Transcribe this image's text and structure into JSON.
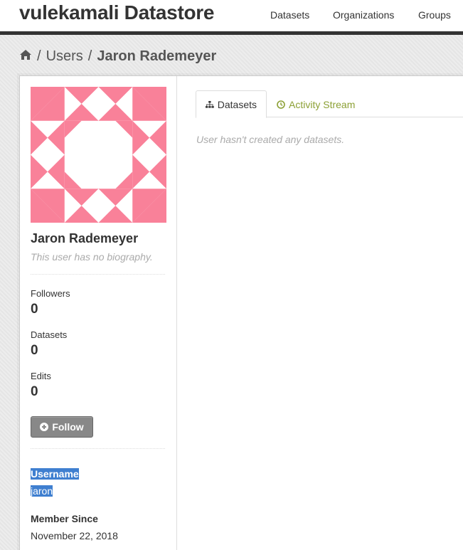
{
  "site": {
    "title": "vulekamali Datastore"
  },
  "nav": {
    "items": [
      "Datasets",
      "Organizations",
      "Groups"
    ]
  },
  "breadcrumb": {
    "users": "Users",
    "current": "Jaron Rademeyer"
  },
  "profile": {
    "name": "Jaron Rademeyer",
    "bio": "This user has no biography.",
    "stats": [
      {
        "label": "Followers",
        "value": "0"
      },
      {
        "label": "Datasets",
        "value": "0"
      },
      {
        "label": "Edits",
        "value": "0"
      }
    ],
    "follow_label": "Follow",
    "username_label": "Username",
    "username": "jaron",
    "member_since_label": "Member Since",
    "member_since": "November 22, 2018"
  },
  "tabs": [
    {
      "label": "Datasets",
      "icon": "sitemap-icon",
      "active": true
    },
    {
      "label": "Activity Stream",
      "icon": "clock-icon",
      "active": false
    }
  ],
  "main": {
    "empty_message": "User hasn't created any datasets."
  },
  "colors": {
    "avatar": "#f98199",
    "accent_green": "#8ca035",
    "selection": "#3f7fd0"
  }
}
